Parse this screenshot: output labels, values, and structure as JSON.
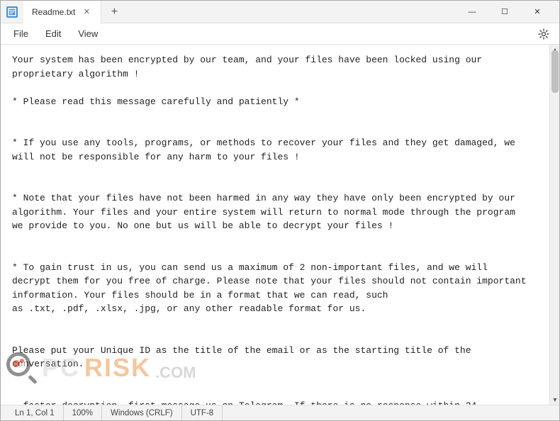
{
  "window": {
    "title": "Readme.txt",
    "icon_label": "N"
  },
  "tabs": [
    {
      "label": "Readme.txt",
      "active": true
    }
  ],
  "controls": {
    "minimize": "—",
    "maximize": "☐",
    "close": "✕",
    "new_tab": "+"
  },
  "menu": {
    "items": [
      "File",
      "Edit",
      "View"
    ]
  },
  "content": {
    "text": "Your system has been encrypted by our team, and your files have been locked using our\nproprietary algorithm !\n\n* Please read this message carefully and patiently *\n\n\n* If you use any tools, programs, or methods to recover your files and they get damaged, we\nwill not be responsible for any harm to your files !\n\n\n* Note that your files have not been harmed in any way they have only been encrypted by our\nalgorithm. Your files and your entire system will return to normal mode through the program\nwe provide to you. No one but us will be able to decrypt your files !\n\n\n* To gain trust in us, you can send us a maximum of 2 non-important files, and we will\ndecrypt them for you free of charge. Please note that your files should not contain important\ninformation. Your files should be in a format that we can read, such\nas .txt, .pdf, .xlsx, .jpg, or any other readable format for us.\n\n\nPlease put your Unique ID as the title of the email or as the starting title of the\nconversation.\n\n\n  faster decryption, first message us on Telegram. If there is no response within 24"
  },
  "status_bar": {
    "position": "Ln 1, Col 1",
    "zoom": "100%",
    "line_ending": "Windows (CRLF)",
    "encoding": "UTF-8"
  },
  "watermark": {
    "pc_text": "PC",
    "risk_text": "RISK",
    "com_text": ".COM"
  }
}
